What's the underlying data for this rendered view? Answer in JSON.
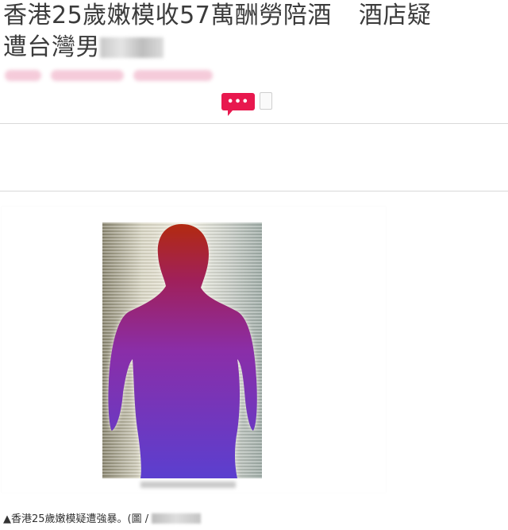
{
  "article": {
    "headline_line1_a": "香港25歲嫩模收57萬酬勞陪酒",
    "headline_line1_b": "酒店疑",
    "headline_line2": "遭台灣男",
    "comment_badge_text": "•••",
    "image_caption": "▲香港25歲嫩模疑遭強暴。(圖 /"
  },
  "colors": {
    "badge": "#e8184e",
    "headline": "#3b3b3b",
    "divider": "#d9d9d9"
  },
  "icons": {
    "comment": "speech-bubble-icon",
    "bookmark": "bookmark-icon"
  }
}
